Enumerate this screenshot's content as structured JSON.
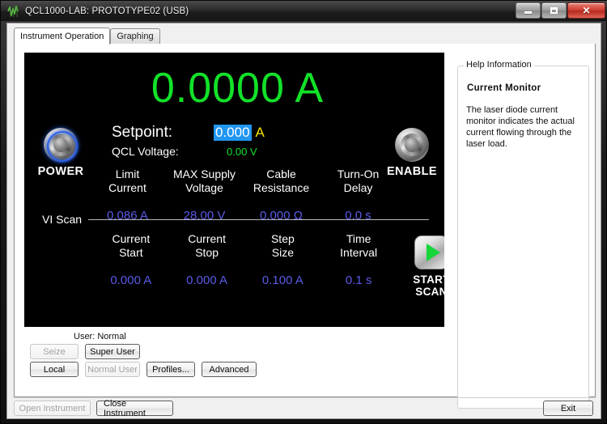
{
  "window": {
    "title": "QCL1000-LAB: PROTOTYPE02 (USB)",
    "icon": "waveform-icon",
    "minimize_label": "",
    "maximize_label": "",
    "close_label": "✕"
  },
  "tabs": [
    {
      "label": "Instrument Operation",
      "active": true
    },
    {
      "label": "Graphing",
      "active": false
    }
  ],
  "instrument": {
    "current_monitor": "0.0000 A",
    "power_button_label": "POWER",
    "enable_button_label": "ENABLE",
    "setpoint_label": "Setpoint:",
    "setpoint_value": "0.000",
    "setpoint_unit": "A",
    "qcl_voltage_label": "QCL Voltage:",
    "qcl_voltage_value": "0.00 V",
    "parameters": [
      {
        "line1": "Limit",
        "line2": "Current",
        "value": "0.086 A"
      },
      {
        "line1": "MAX Supply",
        "line2": "Voltage",
        "value": "28.00 V"
      },
      {
        "line1": "Cable",
        "line2": "Resistance",
        "value": "0.000 Ω"
      },
      {
        "line1": "Turn-On",
        "line2": "Delay",
        "value": "0.0 s"
      }
    ],
    "vi_scan_title": "VI Scan",
    "scan_parameters": [
      {
        "line1": "Current",
        "line2": "Start",
        "value": "0.000 A"
      },
      {
        "line1": "Current",
        "line2": "Stop",
        "value": "0.000 A"
      },
      {
        "line1": "Step",
        "line2": "Size",
        "value": "0.100 A"
      },
      {
        "line1": "Time",
        "line2": "Interval",
        "value": "0.1 s"
      }
    ],
    "start_scan_line1": "START",
    "start_scan_line2": "SCAN",
    "colors": {
      "monitor_green": "#12e228",
      "parameter_blue": "#5a5ae8",
      "setpoint_highlight": "#2196f3",
      "unit_yellow": "#f5e400",
      "panel_background": "#000000"
    }
  },
  "user_section": {
    "user_status": "User: Normal",
    "buttons_row1": [
      {
        "label": "Seize",
        "enabled": false
      },
      {
        "label": "Super User",
        "enabled": true
      }
    ],
    "buttons_row2": [
      {
        "label": "Local",
        "enabled": true
      },
      {
        "label": "Normal User",
        "enabled": false
      },
      {
        "label": "Profiles...",
        "enabled": true
      },
      {
        "label": "Advanced",
        "enabled": true
      }
    ]
  },
  "help": {
    "legend": "Help Information",
    "title": "Current Monitor",
    "body": "The laser diode current monitor indicates the actual current flowing through the laser load."
  },
  "bottom_bar": {
    "open_instrument": "Open Instrument",
    "close_instrument": "Close Instrument",
    "exit": "Exit"
  }
}
